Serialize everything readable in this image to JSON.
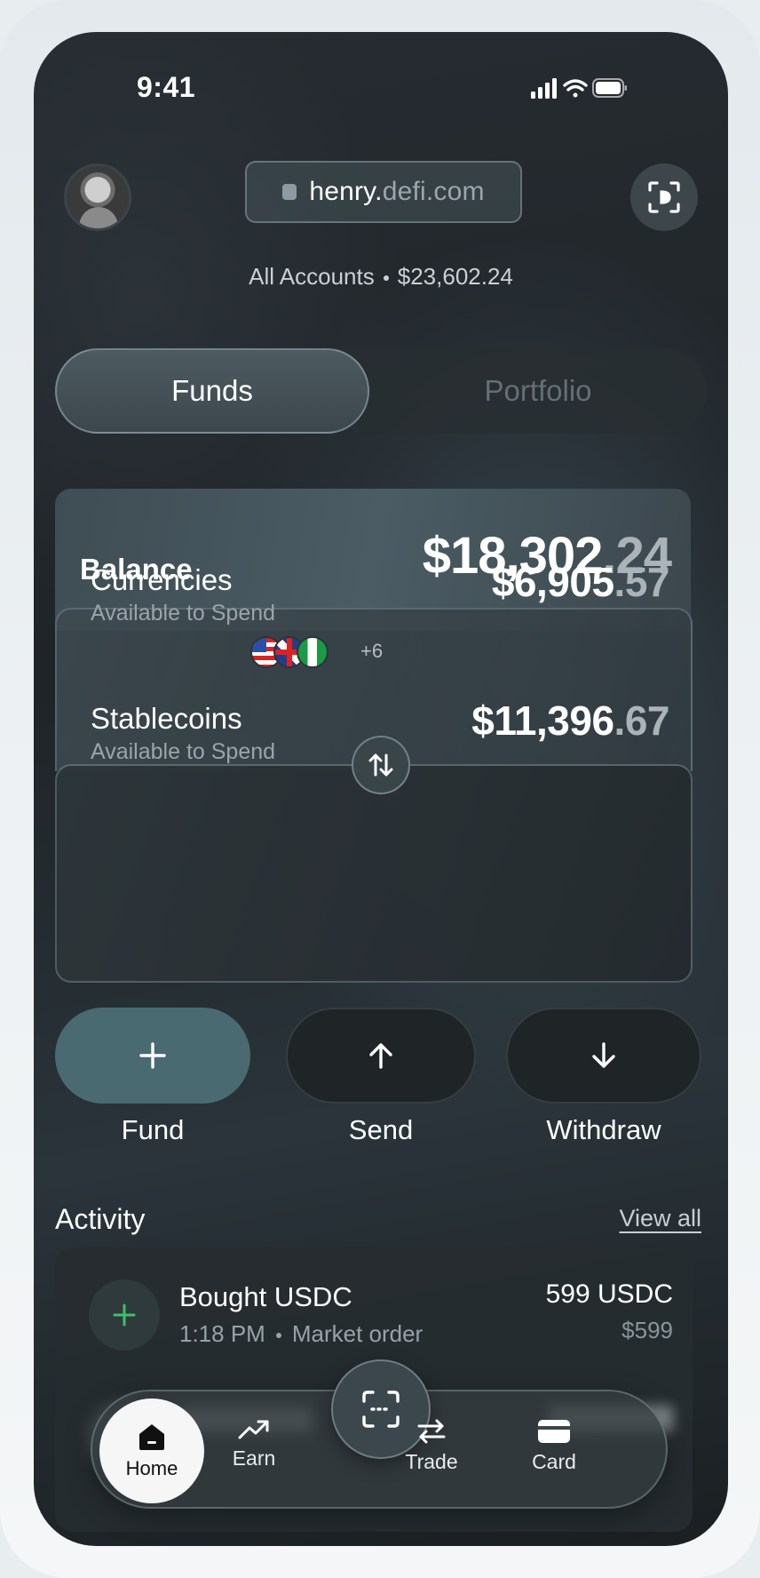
{
  "status_bar": {
    "time": "9:41"
  },
  "header": {
    "domain_host": "henry.",
    "domain_rest": "defi.com",
    "accounts_label": "All Accounts",
    "accounts_total": "$23,602.24"
  },
  "tabs": {
    "funds": "Funds",
    "portfolio": "Portfolio",
    "active": "Funds"
  },
  "balance": {
    "label": "Balance",
    "whole": "$18,302",
    "cents": ".24"
  },
  "currencies": {
    "title": "Currencies",
    "caption": "Available to Spend",
    "more_flags": "+6",
    "flags": [
      "us-flag",
      "uk-flag",
      "ng-flag"
    ],
    "whole": "$6,905",
    "cents": ".57"
  },
  "stablecoins": {
    "title": "Stablecoins",
    "caption": "Available to Spend",
    "whole": "$11,396",
    "cents": ".67"
  },
  "actions": [
    {
      "label": "Fund",
      "icon": "plus-icon"
    },
    {
      "label": "Send",
      "icon": "arrow-up-icon"
    },
    {
      "label": "Withdraw",
      "icon": "arrow-down-icon"
    }
  ],
  "activity": {
    "title": "Activity",
    "view_all": "View all",
    "items": [
      {
        "title": "Bought USDC",
        "time": "1:18 PM",
        "type": "Market order",
        "amount": "599 USDC",
        "usd": "$599"
      }
    ]
  },
  "tabbar": {
    "home": "Home",
    "earn": "Earn",
    "trade": "Trade",
    "card": "Card"
  },
  "colors": {
    "accent": "#4a6a72",
    "positive": "#3fbf6a",
    "background": "#1f2428"
  }
}
